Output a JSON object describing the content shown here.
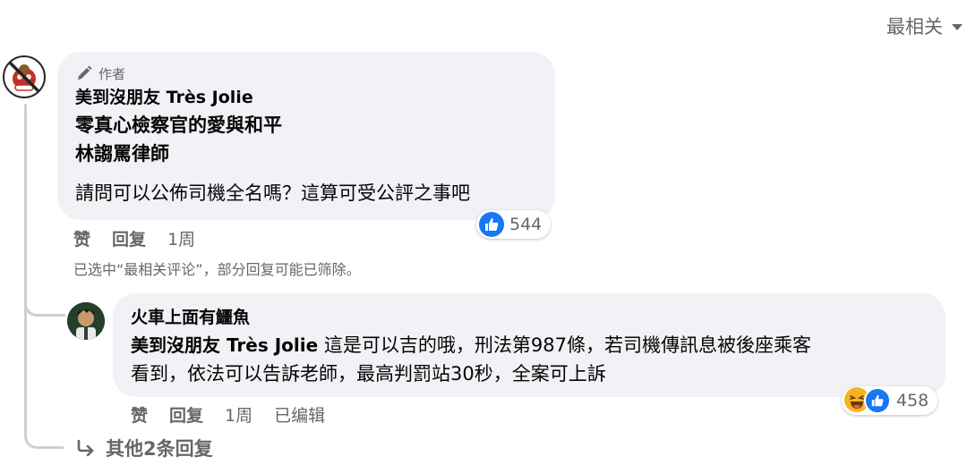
{
  "sort": {
    "label": "最相关"
  },
  "comment1": {
    "author_badge": "作者",
    "name": "美到沒朋友 Très Jolie",
    "tags": [
      "零真心檢察官的愛與和平",
      "林謅罵律師"
    ],
    "text": "請問可以公佈司機全名嗎？這算可受公評之事吧",
    "reactions": {
      "count": "544",
      "icons": [
        "like-icon"
      ]
    },
    "actions": {
      "like": "赞",
      "reply": "回复",
      "time": "1周"
    },
    "filtered_note": "已选中“最相关评论”，部分回复可能已筛除。"
  },
  "reply1": {
    "name": "火車上面有鱷魚",
    "mention": "美到沒朋友 Très Jolie",
    "text_line1": "這是可以吉的哦，刑法第987條，若司機傳訊息被後座乘客",
    "text_line2": "看到，依法可以告訴老師，最高判罰站30秒，全案可上訴",
    "reactions": {
      "count": "458",
      "icons": [
        "haha-icon",
        "like-icon"
      ]
    },
    "actions": {
      "like": "赞",
      "reply": "回复",
      "time": "1周",
      "edited": "已编辑"
    }
  },
  "more_replies": {
    "label": "其他2条回复"
  },
  "colors": {
    "bubble": "#f0f2f5",
    "like_blue": "#1877f2",
    "haha_yellow": "#f7b125",
    "secondary_text": "#65676b"
  }
}
